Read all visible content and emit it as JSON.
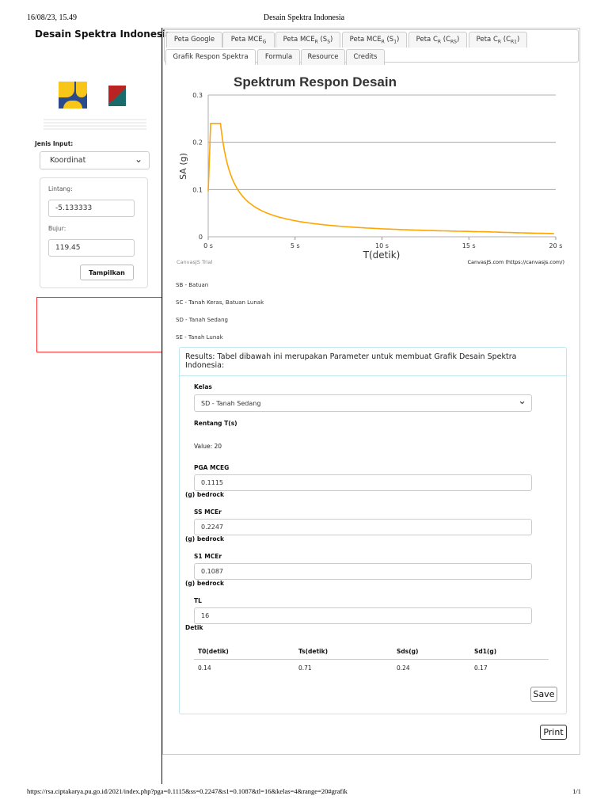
{
  "print_header": {
    "datetime": "16/08/23, 15.49",
    "title": "Desain Spektra Indonesia"
  },
  "print_footer": {
    "url": "https://rsa.ciptakarya.pu.go.id/2021/index.php?pga=0.1115&ss=0.2247&s1=0.1087&tl=16&kelas=4&range=20#grafik",
    "page": "1/1"
  },
  "sidebar": {
    "title": "Desain Spektra Indonesia",
    "logos": [
      "PU logo",
      "PuSGeN logo"
    ],
    "input_type_label": "Jenis Input:",
    "input_type_value": "Koordinat",
    "lat_label": "Lintang:",
    "lat_value": "-5.133333",
    "lon_label": "Bujur:",
    "lon_value": "119.45",
    "show_button": "Tampilkan"
  },
  "tabs": [
    {
      "label": "Peta Google",
      "sub": ""
    },
    {
      "label": "Peta MCE",
      "sub": "G",
      "suffix": ""
    },
    {
      "label": "Peta MCE",
      "sub": "R",
      "suffix": " (S",
      "sub2": "S",
      "end": ")"
    },
    {
      "label": "Peta MCE",
      "sub": "R",
      "suffix": " (S",
      "sub2": "1",
      "end": ")"
    },
    {
      "label": "Peta C",
      "sub": "R",
      "suffix": " (C",
      "sub2": "RS",
      "end": ")"
    },
    {
      "label": "Peta C",
      "sub": "R",
      "suffix": " (C",
      "sub2": "R1",
      "end": ")"
    },
    {
      "label": "Grafik Respon Spektra"
    },
    {
      "label": "Formula"
    },
    {
      "label": "Resource"
    },
    {
      "label": "Credits"
    }
  ],
  "chart_data": {
    "type": "line",
    "title": "Spektrum Respon Desain",
    "xlabel": "T(detik)",
    "ylabel": "SA (g)",
    "xlim": [
      0,
      20
    ],
    "ylim": [
      0,
      0.3
    ],
    "x_ticks": [
      "0 s",
      "5 s",
      "10 s",
      "15 s",
      "20 s"
    ],
    "y_ticks": [
      "0",
      "0.1",
      "0.2",
      "0.3"
    ],
    "grid": true,
    "color": "#FFA500",
    "params": {
      "T0": 0.14,
      "Ts": 0.71,
      "Sds": 0.24,
      "Sd1": 0.17,
      "TL": 16
    },
    "credit_left": "CanvasJS Trial",
    "credit_right": "CanvasJS.com (https://canvasjs.com/)"
  },
  "site_classes": [
    "SB - Batuan",
    "SC - Tanah Keras, Batuan Lunak",
    "SD - Tanah Sedang",
    "SE - Tanah Lunak"
  ],
  "results": {
    "heading": "Results: Tabel dibawah ini merupakan Parameter untuk membuat Grafik Desain Spektra Indonesia:",
    "kelas_label": "Kelas",
    "kelas_value": "SD - Tanah Sedang",
    "range_label": "Rentang T(s)",
    "range_value": "Value: 20",
    "pga_label": "PGA MCEG",
    "pga_value": "0.1115",
    "pga_unit": "(g) bedrock",
    "ss_label": "SS MCEr",
    "ss_value": "0.2247",
    "ss_unit": "(g) bedrock",
    "s1_label": "S1 MCEr",
    "s1_value": "0.1087",
    "s1_unit": "(g) bedrock",
    "tl_label": "TL",
    "tl_value": "16",
    "tl_unit": "Detik",
    "table_headers": [
      "T0(detik)",
      "Ts(detik)",
      "Sds(g)",
      "Sd1(g)"
    ],
    "table_row": [
      "0.14",
      "0.71",
      "0.24",
      "0.17"
    ],
    "save_button": "Save"
  },
  "print_button": "Print"
}
